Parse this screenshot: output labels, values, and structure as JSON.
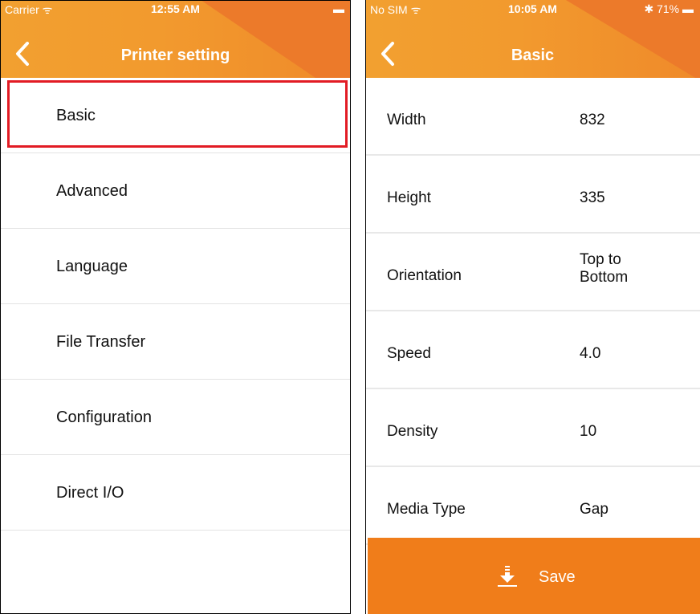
{
  "left_screen": {
    "status": {
      "carrier": "Carrier ᯤ",
      "time": "12:55 AM",
      "right": "▬"
    },
    "title": "Printer setting",
    "items": [
      {
        "label": "Basic"
      },
      {
        "label": "Advanced"
      },
      {
        "label": "Language"
      },
      {
        "label": "File Transfer"
      },
      {
        "label": "Configuration"
      },
      {
        "label": "Direct I/O"
      }
    ]
  },
  "right_screen": {
    "status": {
      "carrier": "No SIM ᯤ",
      "time": "10:05 AM",
      "right": "✱ 71% ▬"
    },
    "title": "Basic",
    "fields": [
      {
        "key": "Width",
        "value": "832"
      },
      {
        "key": "Height",
        "value": "335"
      },
      {
        "key": "Orientation",
        "value_line1": "Top to",
        "value_line2": "Bottom"
      },
      {
        "key": "Speed",
        "value": "4.0"
      },
      {
        "key": "Density",
        "value": "10"
      },
      {
        "key": "Media Type",
        "value": "Gap"
      }
    ],
    "save_label": "Save"
  },
  "colors": {
    "header_orange": "#f29a2e",
    "save_orange": "#f07d1a",
    "highlight_red": "#e21b24"
  }
}
